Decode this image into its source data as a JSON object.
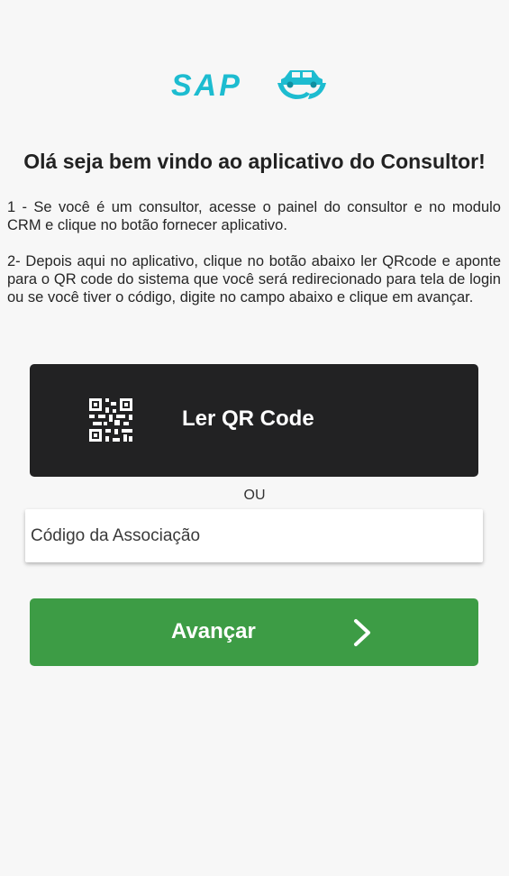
{
  "brand": {
    "logo_text": "SAP",
    "color": "#1dbcd0"
  },
  "heading": "Olá seja bem vindo ao aplicativo do Consultor!",
  "instructions": {
    "step1": "1 - Se você é um consultor, acesse o painel do consultor e no modulo CRM  e clique no botão fornecer aplicativo.",
    "step2": "2- Depois aqui no aplicativo, clique no botão abaixo ler QRcode  e aponte para o QR code do sistema que você será redirecionado para tela de login ou se você tiver o código, digite no campo abaixo e clique em avançar."
  },
  "qr_button": {
    "label": "Ler QR Code",
    "icon": "qr-code-icon",
    "color": "#222223"
  },
  "separator": "OU",
  "code_field": {
    "placeholder": "Código da Associação",
    "value": ""
  },
  "advance_button": {
    "label": "Avançar",
    "icon": "chevron-right-icon",
    "color": "#3d9c45"
  }
}
